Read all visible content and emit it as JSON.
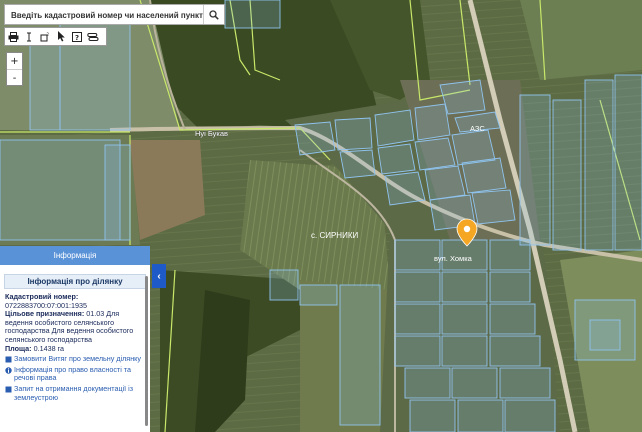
{
  "search": {
    "placeholder": "Введіть кадастровий номер чи населений пункт"
  },
  "toolbar": {
    "tools": [
      {
        "icon": "print-icon"
      },
      {
        "icon": "measure-distance-icon"
      },
      {
        "icon": "measure-area-icon"
      },
      {
        "icon": "pointer-icon"
      },
      {
        "icon": "help-icon"
      },
      {
        "icon": "layers-toggle-icon"
      }
    ]
  },
  "zoom": {
    "in_label": "+",
    "out_label": "-"
  },
  "map": {
    "labels": {
      "road": "Нуі Букав",
      "village": "с. СИРНИКИ",
      "street": "вул. Хомка",
      "gas_station": "АЗС"
    },
    "marker_color": "#f5a623",
    "parcel_color": "#8fc3ee",
    "boundary_color": "#c8e86a"
  },
  "panel": {
    "header": "Інформація",
    "subtitle": "Інформація про ділянку",
    "cadastral_label": "Кадастровий номер:",
    "cadastral_value": "0722883700:07:001:1935",
    "purpose_label": "Цільове призначення:",
    "purpose_value": "01.03 Для ведення особистого селянського господарства Для ведення особистого селянського господарства",
    "area_label": "Площа:",
    "area_value": "0.1438 га",
    "links": [
      "Замовити Витяг про земельну ділянку",
      "Інформація про право власності та речові права",
      "Запит на отримання документації із землеустрою"
    ]
  }
}
